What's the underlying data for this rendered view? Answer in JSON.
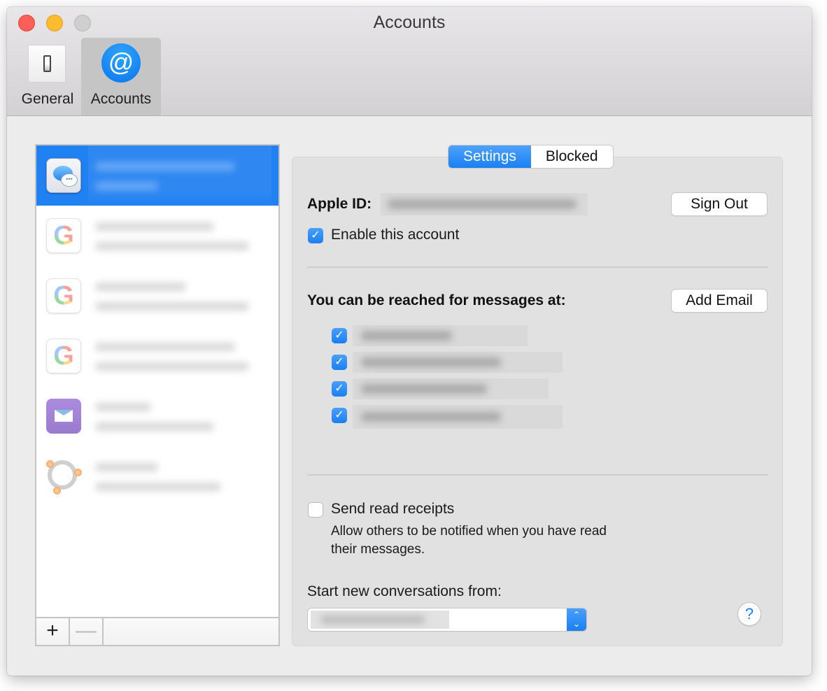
{
  "window": {
    "title": "Accounts",
    "controls": [
      "close",
      "minimize",
      "zoom"
    ]
  },
  "toolbar": {
    "items": [
      {
        "label": "General",
        "icon": "switch-icon",
        "active": false
      },
      {
        "label": "Accounts",
        "icon": "at-sign-icon",
        "glyph": "@",
        "active": true
      }
    ]
  },
  "accounts": {
    "items": [
      {
        "type": "iMessage",
        "icon": "messages-icon",
        "name": "[redacted]",
        "detail": "[redacted]",
        "selected": true
      },
      {
        "type": "Google",
        "icon": "google-icon",
        "glyph": "G",
        "name": "[redacted]",
        "detail": "[redacted]",
        "selected": false
      },
      {
        "type": "Google",
        "icon": "google-icon",
        "glyph": "G",
        "name": "[redacted]",
        "detail": "[redacted]",
        "selected": false
      },
      {
        "type": "Google",
        "icon": "google-icon",
        "glyph": "G",
        "name": "[redacted]",
        "detail": "[redacted]",
        "selected": false
      },
      {
        "type": "Mail",
        "icon": "mail-icon",
        "name": "[redacted]",
        "detail": "[redacted]",
        "selected": false
      },
      {
        "type": "Bonjour",
        "icon": "bonjour-icon",
        "name": "[redacted]",
        "detail": "[redacted]",
        "selected": false
      }
    ],
    "add_label": "+",
    "remove_label": "—"
  },
  "tabs": [
    {
      "label": "Settings",
      "active": true
    },
    {
      "label": "Blocked",
      "active": false
    }
  ],
  "settings": {
    "apple_id_label": "Apple ID:",
    "apple_id_value": "[redacted]",
    "sign_out_label": "Sign Out",
    "enable_account_label": "Enable this account",
    "enable_account_checked": true,
    "reach_label": "You can be reached for messages at:",
    "add_email_label": "Add Email",
    "reach_addresses": [
      {
        "value": "[redacted phone]",
        "checked": true
      },
      {
        "value": "[redacted email]",
        "checked": true
      },
      {
        "value": "[redacted email]",
        "checked": true
      },
      {
        "value": "[redacted email]",
        "checked": true
      }
    ],
    "read_receipts_label": "Send read receipts",
    "read_receipts_checked": false,
    "read_receipts_desc_line1": "Allow others to be notified when you have read",
    "read_receipts_desc_line2": "their messages.",
    "start_from_label": "Start new conversations from:",
    "start_from_value": "[redacted phone]",
    "help_label": "?",
    "check_glyph": "✓"
  },
  "colors": {
    "accent": "#1b7ff3",
    "selection": "#2081f3"
  }
}
